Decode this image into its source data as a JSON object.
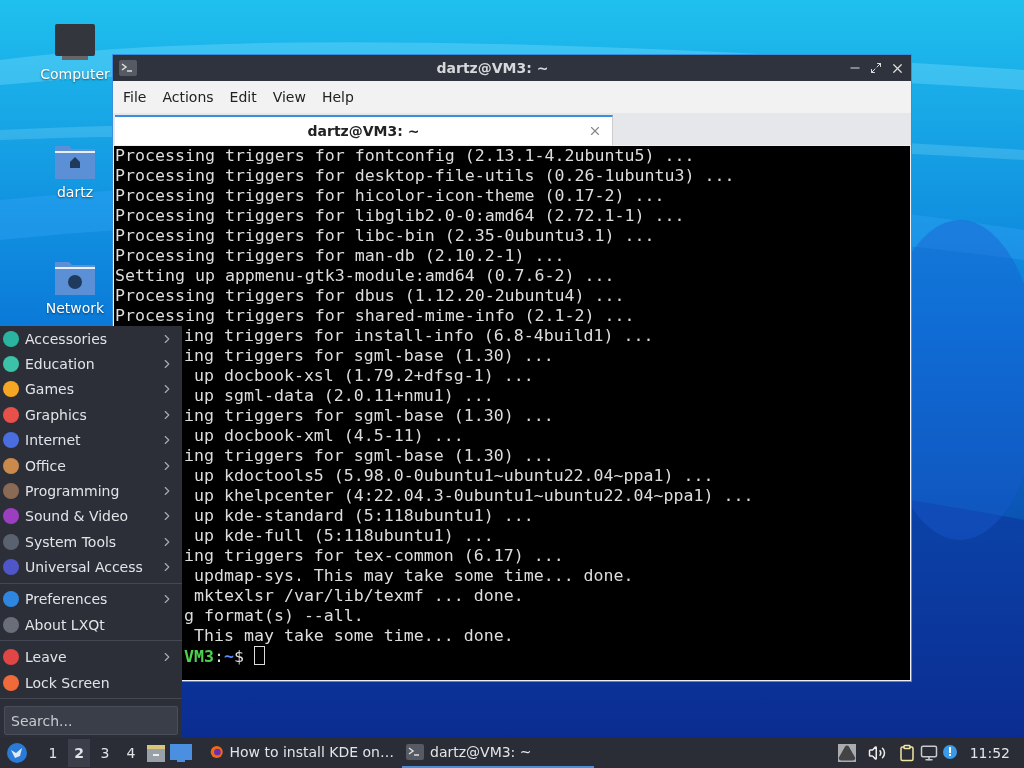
{
  "desktop_icons": [
    {
      "kind": "computer",
      "label": "Computer"
    },
    {
      "kind": "home",
      "label": "dartz"
    },
    {
      "kind": "network",
      "label": "Network"
    }
  ],
  "window": {
    "title": "dartz@VM3: ~",
    "menu": [
      "File",
      "Actions",
      "Edit",
      "View",
      "Help"
    ],
    "tabs": [
      {
        "label": "dartz@VM3: ~",
        "selected": true
      }
    ],
    "terminal": {
      "lines": [
        {
          "text": "Processing triggers for fontconfig (2.13.1-4.2ubuntu5) ...",
          "clipped": false
        },
        {
          "text": "Processing triggers for desktop-file-utils (0.26-1ubuntu3) ...",
          "clipped": false
        },
        {
          "text": "Processing triggers for hicolor-icon-theme (0.17-2) ...",
          "clipped": false
        },
        {
          "text": "Processing triggers for libglib2.0-0:amd64 (2.72.1-1) ...",
          "clipped": false
        },
        {
          "text": "Processing triggers for libc-bin (2.35-0ubuntu3.1) ...",
          "clipped": false
        },
        {
          "text": "Processing triggers for man-db (2.10.2-1) ...",
          "clipped": false
        },
        {
          "text": "Setting up appmenu-gtk3-module:amd64 (0.7.6-2) ...",
          "clipped": false
        },
        {
          "text": "Processing triggers for dbus (1.12.20-2ubuntu4) ...",
          "clipped": false
        },
        {
          "text": "Processing triggers for shared-mime-info (2.1-2) ...",
          "clipped": false
        },
        {
          "text": "ing triggers for install-info (6.8-4build1) ...",
          "clipped": true
        },
        {
          "text": "ing triggers for sgml-base (1.30) ...",
          "clipped": true
        },
        {
          "text": " up docbook-xsl (1.79.2+dfsg-1) ...",
          "clipped": true
        },
        {
          "text": " up sgml-data (2.0.11+nmu1) ...",
          "clipped": true
        },
        {
          "text": "ing triggers for sgml-base (1.30) ...",
          "clipped": true
        },
        {
          "text": " up docbook-xml (4.5-11) ...",
          "clipped": true
        },
        {
          "text": "ing triggers for sgml-base (1.30) ...",
          "clipped": true
        },
        {
          "text": " up kdoctools5 (5.98.0-0ubuntu1~ubuntu22.04~ppa1) ...",
          "clipped": true
        },
        {
          "text": " up khelpcenter (4:22.04.3-0ubuntu1~ubuntu22.04~ppa1) ...",
          "clipped": true
        },
        {
          "text": " up kde-standard (5:118ubuntu1) ...",
          "clipped": true
        },
        {
          "text": " up kde-full (5:118ubuntu1) ...",
          "clipped": true
        },
        {
          "text": "ing triggers for tex-common (6.17) ...",
          "clipped": true
        },
        {
          "text": " updmap-sys. This may take some time... done.",
          "clipped": true
        },
        {
          "text": " mktexlsr /var/lib/texmf ... done.",
          "clipped": true
        },
        {
          "text": "g format(s) --all.",
          "clipped": true
        },
        {
          "text": " This may take some time... done.",
          "clipped": true
        }
      ],
      "prompt": {
        "host": "VM3",
        "colon": ":",
        "path": "~",
        "sign": "$"
      }
    }
  },
  "app_menu": {
    "groups": [
      [
        {
          "label": "Accessories",
          "color": "#2bb5a0",
          "submenu": true
        },
        {
          "label": "Education",
          "color": "#3cc2a6",
          "submenu": true
        },
        {
          "label": "Games",
          "color": "#f5a623",
          "submenu": true
        },
        {
          "label": "Graphics",
          "color": "#e8504a",
          "submenu": true
        },
        {
          "label": "Internet",
          "color": "#4a6ee0",
          "submenu": true
        },
        {
          "label": "Office",
          "color": "#c98a4b",
          "submenu": true
        },
        {
          "label": "Programming",
          "color": "#8a6a55",
          "submenu": true
        },
        {
          "label": "Sound & Video",
          "color": "#9b3fc0",
          "submenu": true
        },
        {
          "label": "System Tools",
          "color": "#5a6270",
          "submenu": true
        },
        {
          "label": "Universal Access",
          "color": "#4f56c8",
          "submenu": true
        }
      ],
      [
        {
          "label": "Preferences",
          "color": "#2f86e0",
          "submenu": true
        },
        {
          "label": "About LXQt",
          "color": "#6a6e78",
          "submenu": false
        }
      ],
      [
        {
          "label": "Leave",
          "color": "#e04646",
          "submenu": true
        },
        {
          "label": "Lock Screen",
          "color": "#f06a3a",
          "submenu": false
        }
      ]
    ],
    "search": {
      "placeholder": "Search..."
    }
  },
  "taskbar": {
    "desktops": [
      {
        "label": "1",
        "selected": false
      },
      {
        "label": "2",
        "selected": true
      },
      {
        "label": "3",
        "selected": false
      },
      {
        "label": "4",
        "selected": false
      }
    ],
    "tasks": [
      {
        "kind": "browser",
        "label": "How to install KDE on…",
        "selected": false
      },
      {
        "kind": "terminal",
        "label": "dartz@VM3: ~",
        "selected": true
      }
    ],
    "clock": "11:52"
  }
}
